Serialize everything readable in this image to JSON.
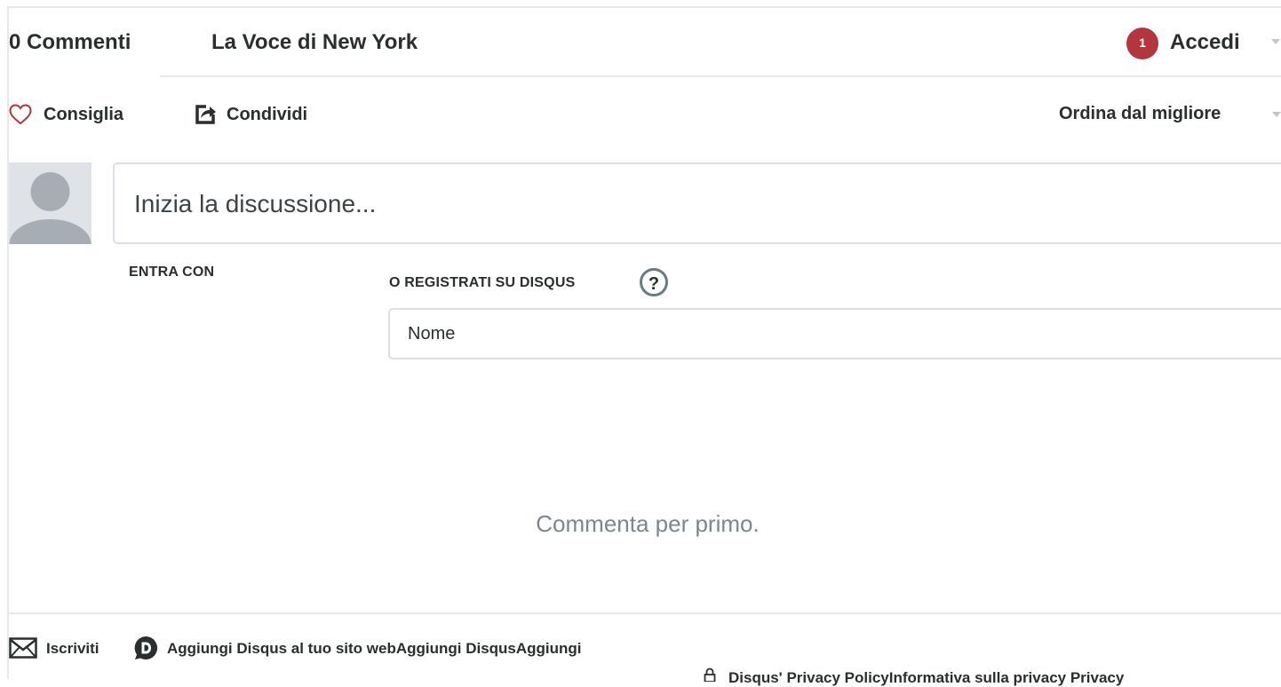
{
  "header": {
    "comment_count_label": "0 Commenti",
    "forum_name": "La Voce di New York",
    "notification_count": "1",
    "login_label": "Accedi"
  },
  "actions": {
    "recommend_label": "Consiglia",
    "share_label": "Condividi",
    "sort_label": "Ordina dal migliore"
  },
  "composer": {
    "placeholder": "Inizia la discussione..."
  },
  "auth": {
    "login_with_label": "ENTRA CON",
    "register_label": "O REGISTRATI SU DISQUS",
    "help_label": "?",
    "name_placeholder": "Nome"
  },
  "empty_state": {
    "message": "Commenta per primo."
  },
  "footer": {
    "subscribe_label": "Iscriviti",
    "add_disqus_label": "Aggiungi Disqus al tuo sito webAggiungi DisqusAggiungi",
    "privacy_label": "Disqus' Privacy PolicyInformativa sulla privacy Privacy"
  },
  "colors": {
    "notification_badge": "#b3363f",
    "heart_icon": "#b3363f",
    "divider": "#e7e9ee",
    "muted_text": "#7d868f"
  },
  "icons": [
    "heart-icon",
    "share-icon",
    "caret-down-icon",
    "avatar-placeholder-icon",
    "help-icon",
    "mail-icon",
    "disqus-logo-icon",
    "lock-icon"
  ]
}
